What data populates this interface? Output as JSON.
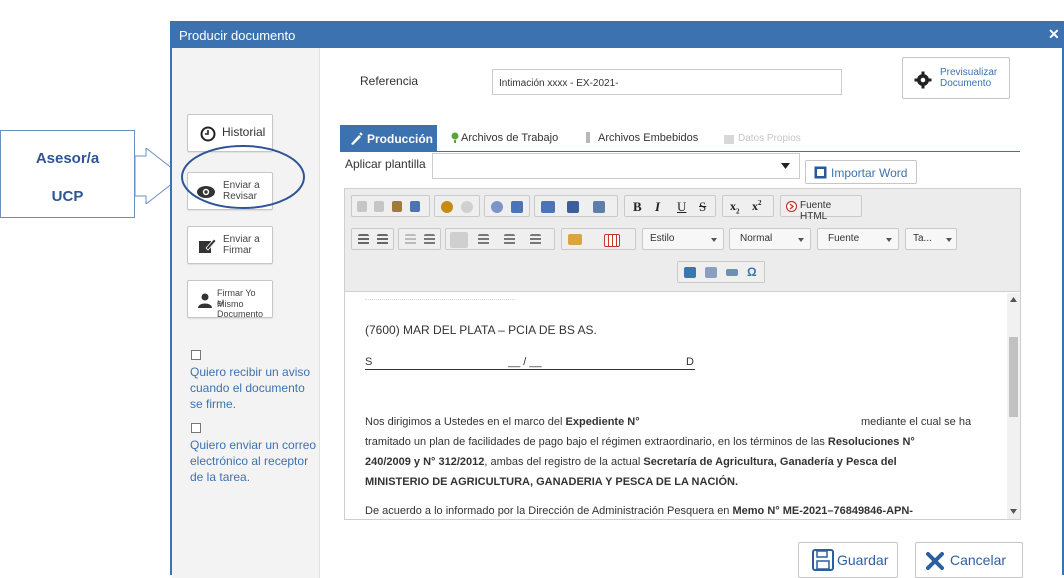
{
  "callout": {
    "line1": "Asesor/a",
    "line2": "UCP"
  },
  "window": {
    "title": "Producir documento",
    "close": "✕"
  },
  "sidebar": {
    "historial": "Historial",
    "enviar_revisar": [
      "Enviar a",
      "Revisar"
    ],
    "enviar_firmar": [
      "Enviar a",
      "Firmar"
    ],
    "firmar_mismo": [
      "Firmar Yo Mismo",
      "el Documento"
    ],
    "aviso_text": "Quiero recibir un aviso cuando el documento se firme.",
    "correo_text": "Quiero enviar un correo electrónico al receptor de la tarea."
  },
  "form": {
    "referencia_label": "Referencia",
    "referencia_value": "Intimación xxxx -  EX-2021-",
    "preview": [
      "Previsualizar",
      "Documento"
    ]
  },
  "tabs": [
    "Producción",
    "Archivos de Trabajo",
    "Archivos Embebidos",
    "Datos Propios"
  ],
  "plantilla": {
    "label": "Aplicar plantilla",
    "value": "",
    "import": "Importar Word"
  },
  "toolbar": {
    "bold": "B",
    "italic": "I",
    "underline": "U",
    "strike": "S",
    "sub": "x",
    "sup": "x",
    "fuente_html": "Fuente HTML",
    "estilo": "Estilo",
    "normal": "Normal",
    "fuente": "Fuente",
    "tamano": "Ta...",
    "omega": "Ω"
  },
  "document": {
    "address": "(7600) MAR DEL PLATA – PCIA DE BS AS.",
    "sd_s": "S",
    "sd_slash": "__ / __",
    "sd_d": "D",
    "p1_a": "Nos dirigimos a Ustedes en el marco del ",
    "p1_b": "Expediente N°",
    "p1_c": "mediante el cual se ha",
    "p1_l2a": "tramitado un plan de facilidades de pago bajo el régimen extraordinario, en los términos de las ",
    "p1_l2b": "Resoluciones N°",
    "p1_l3a": "240/2009 y N° 312/2012",
    "p1_l3b": ", ambas del registro de la actual ",
    "p1_l3c": "Secretaría de Agricultura, Ganadería y Pesca del",
    "p1_l4": "MINISTERIO DE AGRICULTURA, GANADERIA Y PESCA DE LA NACIÓN.",
    "p2_a": "De acuerdo a lo informado por la Dirección de Administración Pesquera en ",
    "p2_b": "Memo N° ME-2021–76849846-APN-"
  },
  "footer": {
    "guardar": "Guardar",
    "cancelar": "Cancelar"
  }
}
